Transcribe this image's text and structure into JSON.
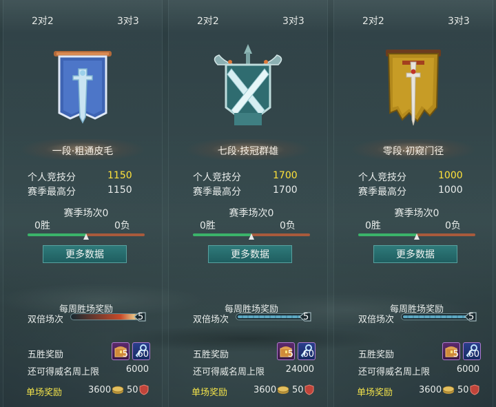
{
  "panels": [
    {
      "tabs": [
        "2对2",
        "3对3"
      ],
      "emblem": "blue-banner-sword-icon",
      "rank": "一段·粗通皮毛",
      "personal_score_label": "个人竞技分",
      "personal_score": "1150",
      "season_high_label": "赛季最高分",
      "season_high": "1150",
      "season_matches": "赛季场次0",
      "wins": "0胜",
      "losses": "0负",
      "win_ratio": 0.5,
      "more_button": "更多数据",
      "weekly_reward": "每周胜场奖励",
      "double_matches": "双倍场次",
      "double_count": "5",
      "double_progress": 0.0,
      "five_win_reward": "五胜奖励",
      "chest_count": "5",
      "key_count": "60",
      "prestige_cap_label": "还可得威名周上限",
      "prestige_cap": "6000",
      "single_reward_label": "单场奖励",
      "single_coin": "3600",
      "single_shield": "50"
    },
    {
      "tabs": [
        "2对2",
        "3对3"
      ],
      "emblem": "crossed-swords-crest-icon",
      "rank": "七段·技冠群雄",
      "personal_score_label": "个人竞技分",
      "personal_score": "1700",
      "season_high_label": "赛季最高分",
      "season_high": "1700",
      "season_matches": "赛季场次0",
      "wins": "0胜",
      "losses": "0负",
      "win_ratio": 0.5,
      "more_button": "更多数据",
      "weekly_reward": "每周胜场奖励",
      "double_matches": "双倍场次",
      "double_count": "5",
      "double_progress": 0.0,
      "five_win_reward": "五胜奖励",
      "chest_count": "5",
      "key_count": "60",
      "prestige_cap_label": "还可得威名周上限",
      "prestige_cap": "24000",
      "single_reward_label": "单场奖励",
      "single_coin": "3600",
      "single_shield": "50"
    },
    {
      "tabs": [
        "2对2",
        "3对3"
      ],
      "emblem": "gold-banner-sword-icon",
      "rank": "零段·初窥门径",
      "personal_score_label": "个人竞技分",
      "personal_score": "1000",
      "season_high_label": "赛季最高分",
      "season_high": "1000",
      "season_matches": "赛季场次0",
      "wins": "0胜",
      "losses": "0负",
      "win_ratio": 0.5,
      "more_button": "更多数据",
      "weekly_reward": "每周胜场奖励",
      "double_matches": "双倍场次",
      "double_count": "5",
      "double_progress": 0.0,
      "five_win_reward": "五胜奖励",
      "chest_count": "5",
      "key_count": "60",
      "prestige_cap_label": "还可得威名周上限",
      "prestige_cap": "6000",
      "single_reward_label": "单场奖励",
      "single_coin": "3600",
      "single_shield": "50"
    }
  ],
  "colors": {
    "highlight_score": "#ffe23a",
    "single_reward": "#f2e24a",
    "win_bar": "#3bb36a",
    "loss_bar": "#a85a3c",
    "button": "#2f7a7a"
  }
}
